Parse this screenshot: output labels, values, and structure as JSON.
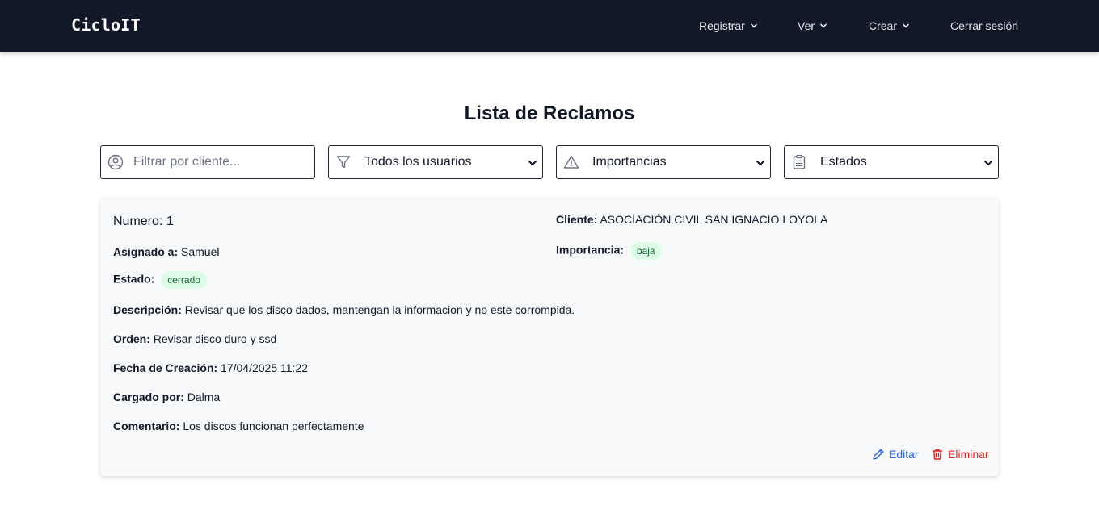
{
  "navbar": {
    "brand": "CicloIT",
    "items": [
      {
        "label": "Registrar",
        "has_dropdown": true
      },
      {
        "label": "Ver",
        "has_dropdown": true
      },
      {
        "label": "Crear",
        "has_dropdown": true
      },
      {
        "label": "Cerrar sesión",
        "has_dropdown": false
      }
    ]
  },
  "page": {
    "title": "Lista de Reclamos"
  },
  "filters": {
    "client_placeholder": "Filtrar por cliente...",
    "client_value": "",
    "user_selected": "Todos los usuarios",
    "importance_selected": "Importancias",
    "status_selected": "Estados"
  },
  "claim": {
    "numero_label": "Numero:",
    "numero": "1",
    "cliente_label": "Cliente:",
    "cliente": "ASOCIACIÓN CIVIL SAN IGNACIO LOYOLA",
    "asignado_label": "Asignado a:",
    "asignado": "Samuel",
    "importancia_label": "Importancia:",
    "importancia": "baja",
    "estado_label": "Estado:",
    "estado": "cerrado",
    "descripcion_label": "Descripción:",
    "descripcion": "Revisar que los disco dados, mantengan la informacion y no este corrompida.",
    "orden_label": "Orden:",
    "orden": "Revisar disco duro y ssd",
    "fecha_label": "Fecha de Creación:",
    "fecha": "17/04/2025 11:22",
    "cargado_label": "Cargado por:",
    "cargado": "Dalma",
    "comentario_label": "Comentario:",
    "comentario": "Los discos funcionan perfectamente",
    "edit_label": "Editar",
    "delete_label": "Eliminar"
  },
  "colors": {
    "navbar_bg": "#111827",
    "pill_bg": "#dcfce7",
    "pill_text": "#166534",
    "edit": "#2563eb",
    "delete": "#dc2626"
  },
  "icons": {
    "filter_client": "user-circle-icon",
    "filter_user": "funnel-icon",
    "filter_importance": "warning-triangle-icon",
    "filter_status": "clipboard-list-icon",
    "edit": "pencil-icon",
    "delete": "trash-icon",
    "dropdown": "chevron-down-icon"
  }
}
